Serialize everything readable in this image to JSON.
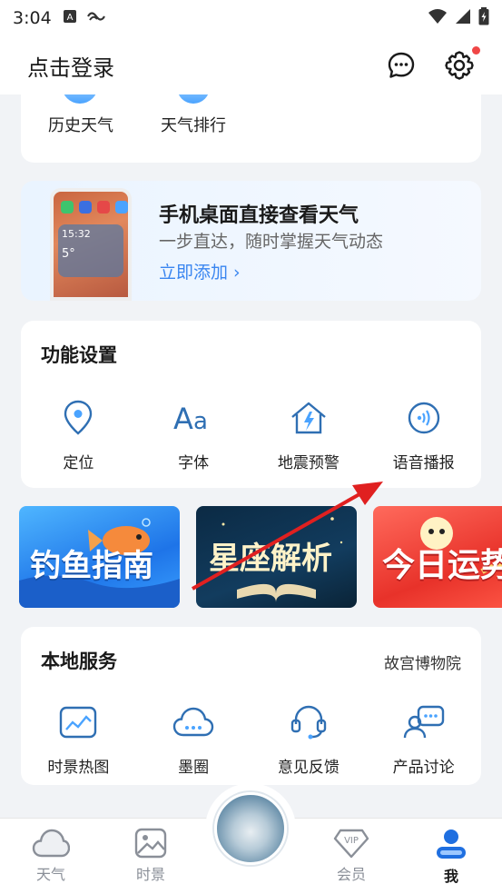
{
  "status_bar": {
    "time": "3:04"
  },
  "header": {
    "login_text": "点击登录"
  },
  "top_card": {
    "items": [
      {
        "label": "历史天气"
      },
      {
        "label": "天气排行"
      }
    ]
  },
  "promo": {
    "title": "手机桌面直接查看天气",
    "subtitle": "一步直达，随时掌握天气动态",
    "link": "立即添加 ›",
    "phone_time": "15:32",
    "phone_temp": "5°"
  },
  "settings": {
    "title": "功能设置",
    "items": [
      {
        "label": "定位",
        "icon": "location-icon"
      },
      {
        "label": "字体",
        "icon": "font-icon"
      },
      {
        "label": "地震预警",
        "icon": "earthquake-icon"
      },
      {
        "label": "语音播报",
        "icon": "voice-broadcast-icon"
      }
    ]
  },
  "banners": [
    {
      "text": "钓鱼指南"
    },
    {
      "text": "星座解析"
    },
    {
      "text": "今日运势"
    }
  ],
  "local": {
    "title": "本地服务",
    "link": "故宫博物院",
    "items": [
      {
        "label": "时景热图",
        "icon": "heatmap-icon"
      },
      {
        "label": "墨圈",
        "icon": "cloud-chat-icon"
      },
      {
        "label": "意见反馈",
        "icon": "headset-icon"
      },
      {
        "label": "产品讨论",
        "icon": "discussion-icon"
      }
    ]
  },
  "nav": {
    "items": [
      {
        "label": "天气",
        "icon": "cloud-icon"
      },
      {
        "label": "时景",
        "icon": "picture-icon"
      },
      {
        "label": "会员",
        "icon": "vip-icon"
      },
      {
        "label": "我",
        "icon": "user-icon"
      }
    ],
    "active": "我"
  },
  "colors": {
    "accent": "#3a86f0",
    "badge": "#f04646",
    "icon_blue": "#2f6fb3"
  }
}
